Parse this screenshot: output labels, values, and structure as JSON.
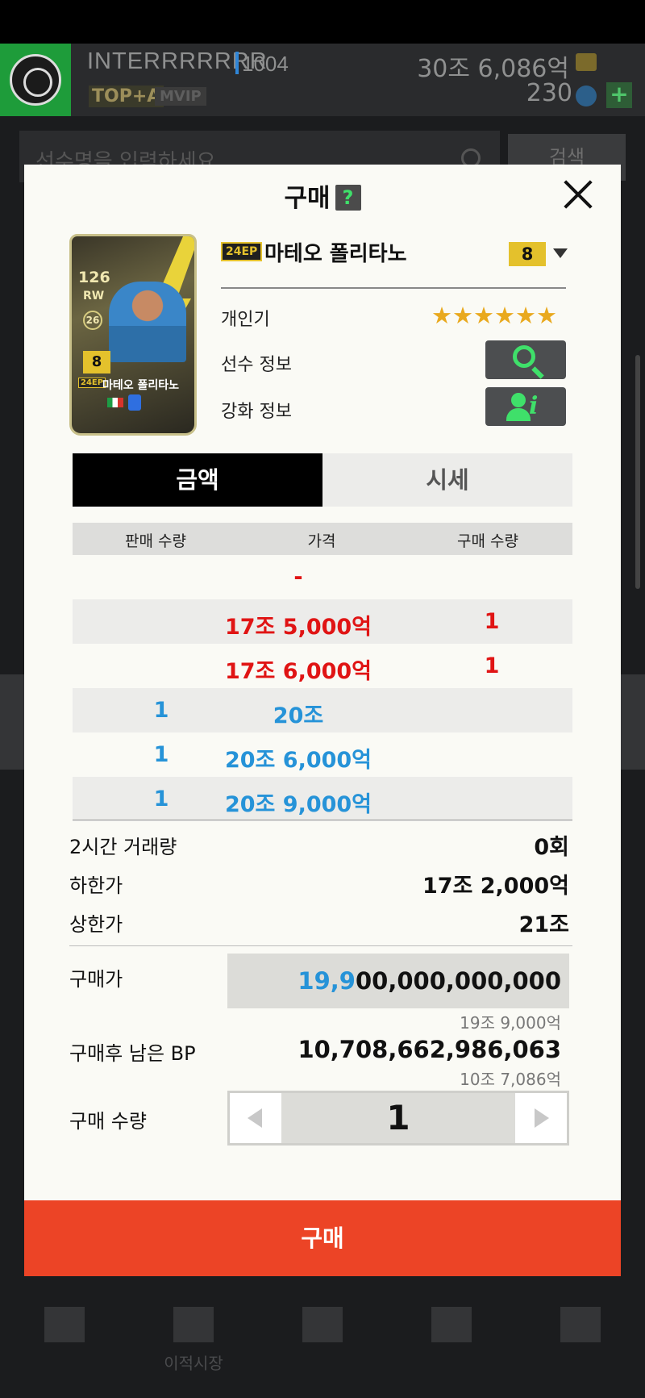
{
  "header": {
    "club_name": "INTERRRRRRR",
    "club_level": "1004",
    "badge": "TOP+A",
    "vip": "MVIP",
    "bp_amount": "30조 6,086억",
    "fc_amount": "230",
    "add_label": "+"
  },
  "search": {
    "placeholder": "선수명을 입력하세요",
    "button_label": "검색"
  },
  "bottom_nav": {
    "items": [
      {
        "label": "",
        "icon": "cart-icon"
      },
      {
        "label": "이적시장",
        "icon": "transfer-icon"
      },
      {
        "label": "",
        "icon": "home-icon"
      },
      {
        "label": "",
        "icon": "field-icon"
      },
      {
        "label": "",
        "icon": "briefcase-icon"
      }
    ]
  },
  "modal": {
    "title": "구매",
    "help": "?",
    "player": {
      "season": "24EP",
      "name": "마테오 폴리타노",
      "grade": "8",
      "card": {
        "ovr": "126",
        "position": "RW",
        "pos_number": "26",
        "grade": "8",
        "season": "24EP",
        "name": "마테오 폴리타노"
      }
    },
    "info": {
      "popularity_label": "개인기",
      "stars": "★★★★★★",
      "star_count": 6,
      "player_info_label": "선수 정보",
      "enhance_info_label": "강화 정보"
    },
    "tabs": [
      {
        "label": "금액",
        "active": true
      },
      {
        "label": "시세",
        "active": false
      }
    ],
    "table": {
      "headers": [
        "판매 수량",
        "가격",
        "구매 수량"
      ],
      "rows": [
        {
          "sell": "",
          "price": "-",
          "buy": "",
          "color": "red",
          "shade": false
        },
        {
          "sell": "",
          "price": "17조 5,000억",
          "buy": "1",
          "color": "red",
          "shade": true
        },
        {
          "sell": "",
          "price": "17조 6,000억",
          "buy": "1",
          "color": "red",
          "shade": false
        },
        {
          "sell": "1",
          "price": "20조",
          "buy": "",
          "color": "blue",
          "shade": true
        },
        {
          "sell": "1",
          "price": "20조 6,000억",
          "buy": "",
          "color": "blue",
          "shade": false
        },
        {
          "sell": "1",
          "price": "20조 9,000억",
          "buy": "",
          "color": "blue",
          "shade": true
        }
      ]
    },
    "stats": {
      "volume_label": "2시간 거래량",
      "volume_value": "0회",
      "min_label": "하한가",
      "min_value": "17조 2,000억",
      "max_label": "상한가",
      "max_value": "21조"
    },
    "purchase": {
      "price_label": "구매가",
      "price_highlight": "19,9",
      "price_rest": "00,000,000,000",
      "price_short": "19조 9,000억",
      "remaining_label": "구매후 남은 BP",
      "remaining_value": "10,708,662,986,063",
      "remaining_short": "10조 7,086억",
      "quantity_label": "구매 수량",
      "quantity": "1"
    },
    "buy_button": "구매"
  },
  "colors": {
    "accent_buy": "#ec4426",
    "sell_red": "#e01414",
    "buy_blue": "#2693d8",
    "grade_gold": "#e4c12c",
    "icon_green": "#3fe06a"
  }
}
